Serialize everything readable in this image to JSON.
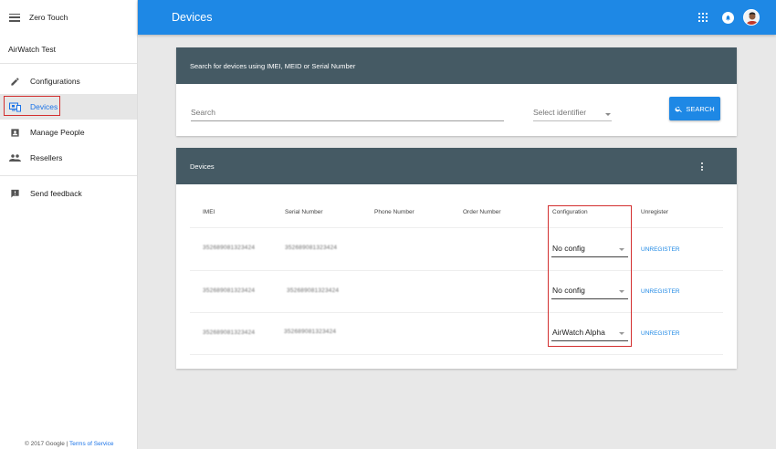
{
  "sidebar": {
    "app_title": "Zero Touch",
    "org_name": "AirWatch Test",
    "items": [
      {
        "label": "Configurations",
        "icon": "pencil-icon"
      },
      {
        "label": "Devices",
        "icon": "devices-icon"
      },
      {
        "label": "Manage People",
        "icon": "person-icon"
      },
      {
        "label": "Resellers",
        "icon": "people-icon"
      }
    ],
    "feedback_label": "Send feedback",
    "footer": {
      "copyright": "© 2017 Google |",
      "terms_link": "Terms of Service"
    }
  },
  "topbar": {
    "title": "Devices"
  },
  "search": {
    "header": "Search for devices using IMEI, MEID or Serial Number",
    "input_placeholder": "Search",
    "identifier_placeholder": "Select identifier",
    "button_label": "SEARCH"
  },
  "devices": {
    "header": "Devices",
    "columns": [
      "IMEI",
      "Serial Number",
      "Phone Number",
      "Order Number",
      "Configuration",
      "Unregister"
    ],
    "rows": [
      {
        "imei": "352689081323424",
        "serial": "352689081323424",
        "configuration": "No config",
        "action": "UNREGISTER"
      },
      {
        "imei": "352689081323424",
        "serial": "352689081323424",
        "configuration": "No config",
        "action": "UNREGISTER"
      },
      {
        "imei": "352689081323424",
        "serial": "352689081323424",
        "configuration": "AirWatch Alpha",
        "action": "UNREGISTER"
      }
    ]
  },
  "colors": {
    "accent": "#1e88e5",
    "header": "#455a64",
    "highlight": "#d32f2f"
  }
}
